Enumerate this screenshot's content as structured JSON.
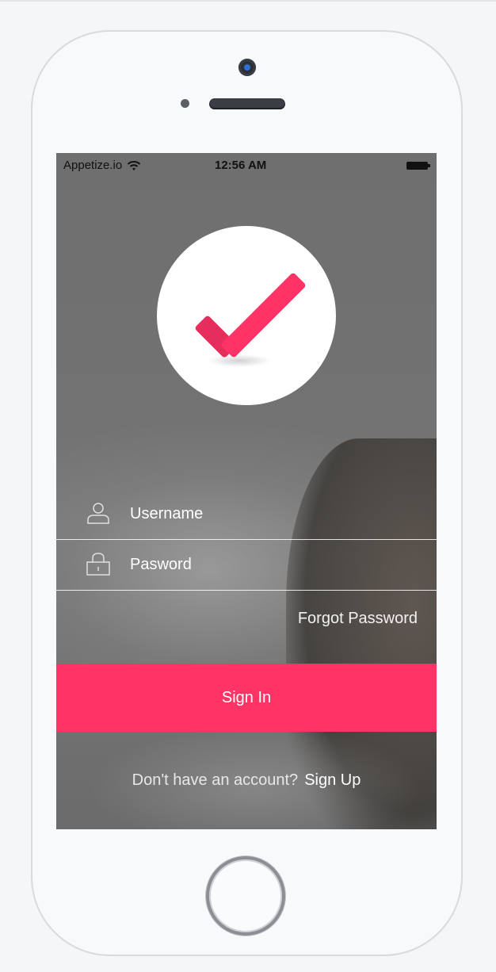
{
  "status_bar": {
    "carrier": "Appetize.io",
    "time": "12:56 AM",
    "wifi_icon": "wifi-icon",
    "battery_icon": "battery-icon"
  },
  "logo": {
    "icon": "checkmark-icon",
    "accent_color": "#ff3366",
    "background_color": "#ffffff"
  },
  "form": {
    "username": {
      "icon": "user-icon",
      "placeholder": "Username",
      "value": ""
    },
    "password": {
      "icon": "lock-icon",
      "placeholder": "Pasword",
      "value": ""
    },
    "forgot_password_label": "Forgot Password",
    "sign_in_label": "Sign In",
    "sign_in_color": "#ff3366"
  },
  "footer": {
    "prompt": "Don't have an account?",
    "sign_up_label": "Sign Up"
  }
}
